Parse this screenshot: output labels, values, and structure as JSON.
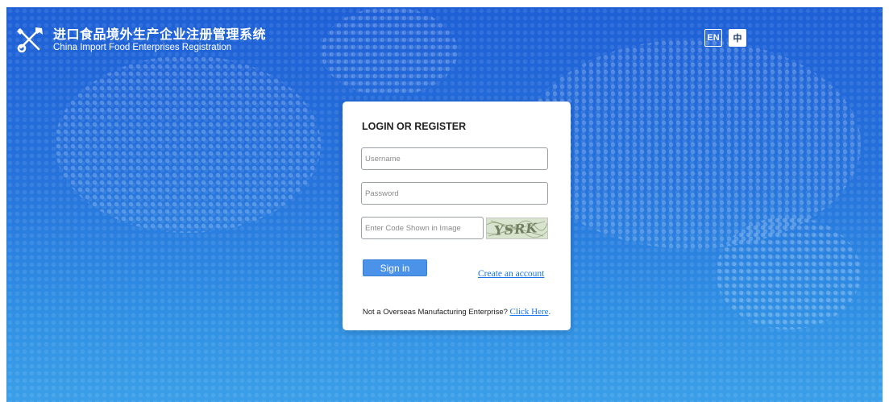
{
  "header": {
    "title_cn": "进口食品境外生产企业注册管理系统",
    "title_en": "China Import Food Enterprises Registration"
  },
  "lang": {
    "en_label": "EN",
    "zh_label": "中"
  },
  "login": {
    "title": "LOGIN OR REGISTER",
    "username_placeholder": "Username",
    "password_placeholder": "Password",
    "code_placeholder": "Enter Code Shown in Image",
    "captcha_text": "YSRK",
    "signin_label": "Sign in",
    "create_account_label": "Create an account",
    "footer_text": "Not a Overseas Manufacturing Enterprise?",
    "footer_link": "Click Here",
    "footer_end": "."
  },
  "colors": {
    "background_top": "#1e5fd6",
    "background_bottom": "#3a9fe8",
    "button": "#4a93e8",
    "link": "#1a73e8"
  }
}
